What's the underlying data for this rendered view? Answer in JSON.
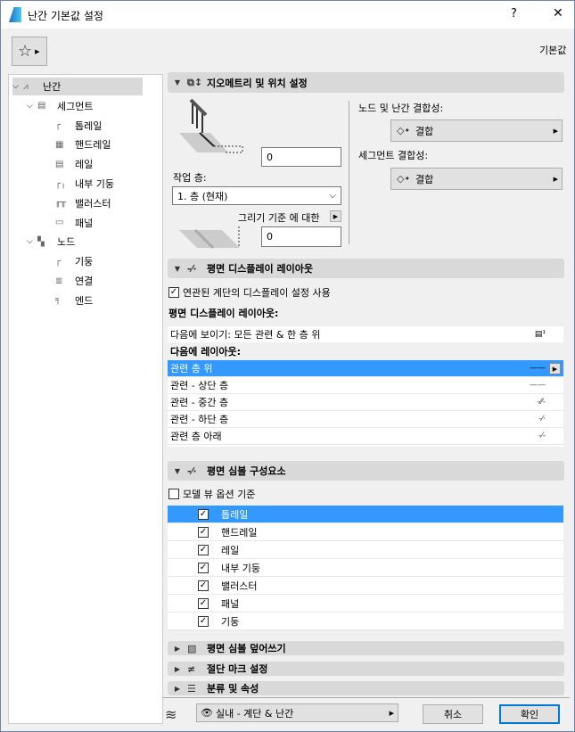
{
  "window": {
    "title": "난간 기본값 설정",
    "help": "?",
    "close": "✕"
  },
  "toolbar": {
    "favorites_icon": "☆",
    "defaults_label": "기본값"
  },
  "tree": [
    {
      "label": "난간",
      "level": 0
    },
    {
      "label": "세그먼트",
      "level": 1
    },
    {
      "label": "톱레일",
      "level": 2
    },
    {
      "label": "핸드레일",
      "level": 2
    },
    {
      "label": "레일",
      "level": 2
    },
    {
      "label": "내부 기둥",
      "level": 2
    },
    {
      "label": "밸러스터",
      "level": 2
    },
    {
      "label": "패널",
      "level": 2
    },
    {
      "label": "노드",
      "level": 1
    },
    {
      "label": "기둥",
      "level": 2
    },
    {
      "label": "연결",
      "level": 2
    },
    {
      "label": "엔드",
      "level": 2
    }
  ],
  "geometry": {
    "title": "지오메트리 및 위치 설정",
    "offset_value": "0",
    "story_label": "작업 층:",
    "story_value": "1. 층 (현재)",
    "ref_label": "그리기 기준 에 대한",
    "ref_value": "0",
    "node_conn_label": "노드 및 난간 결합성:",
    "node_conn_value": "결합",
    "seg_conn_label": "세그먼트 결합성:",
    "seg_conn_value": "결합"
  },
  "plan_display": {
    "title": "평면 디스플레이 레이아웃",
    "use_stair_label": "연관된 계단의 디스플레이 설정 사용",
    "layout_label": "평면 디스플레이 레이아웃:",
    "show_on": "다음에 보이기: 모든 관련 & 한 층 위",
    "layout_on_label": "다음에 레이아웃:",
    "rows": [
      "관련 층 위",
      "관련 - 상단 층",
      "관련 - 중간 층",
      "관련 - 하단 층",
      "관련 층 아래"
    ]
  },
  "symbol": {
    "title": "평면 심볼 구성요소",
    "model_view_label": "모델 뷰 옵션 기준",
    "items": [
      "톱레일",
      "핸드레일",
      "레일",
      "내부 기둥",
      "밸러스터",
      "패널",
      "기둥"
    ]
  },
  "collapsed_sections": [
    "평면 심볼 덮어쓰기",
    "절단 마크 설정",
    "분류 및 속성"
  ],
  "footer": {
    "view_option": "실내 - 계단 & 난간",
    "cancel": "취소",
    "ok": "확인"
  }
}
